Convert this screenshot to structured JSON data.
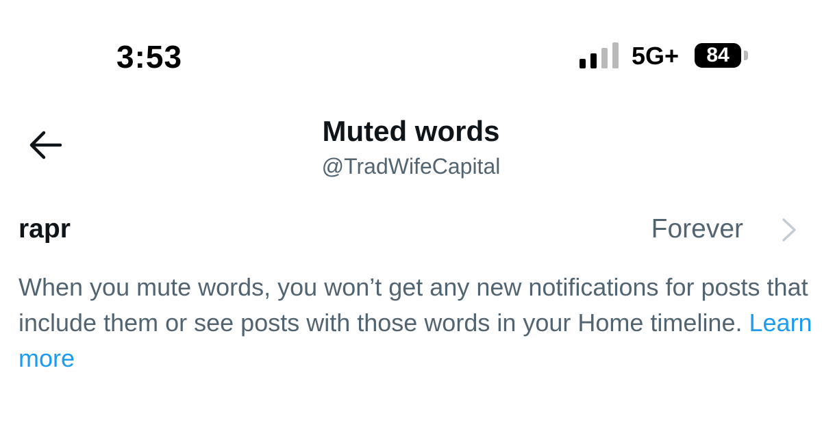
{
  "status_bar": {
    "time": "3:53",
    "network": "5G+",
    "battery": "84",
    "signal_bars_active": 2,
    "signal_bars_total": 4
  },
  "header": {
    "title": "Muted words",
    "handle": "@TradWifeCapital",
    "back_icon": "arrow-left-icon"
  },
  "muted_words": [
    {
      "word": "rapr",
      "duration": "Forever",
      "icon": "chevron-right-icon"
    }
  ],
  "description": {
    "text": "When you mute words, you won’t get any new notifications for posts that include them or see posts with those words in your Home timeline.",
    "link_label": "Learn more"
  },
  "colors": {
    "primary_text": "#0f1419",
    "secondary_text": "#536471",
    "accent": "#1d9bf0",
    "signal_inactive": "#b9b9b9"
  }
}
